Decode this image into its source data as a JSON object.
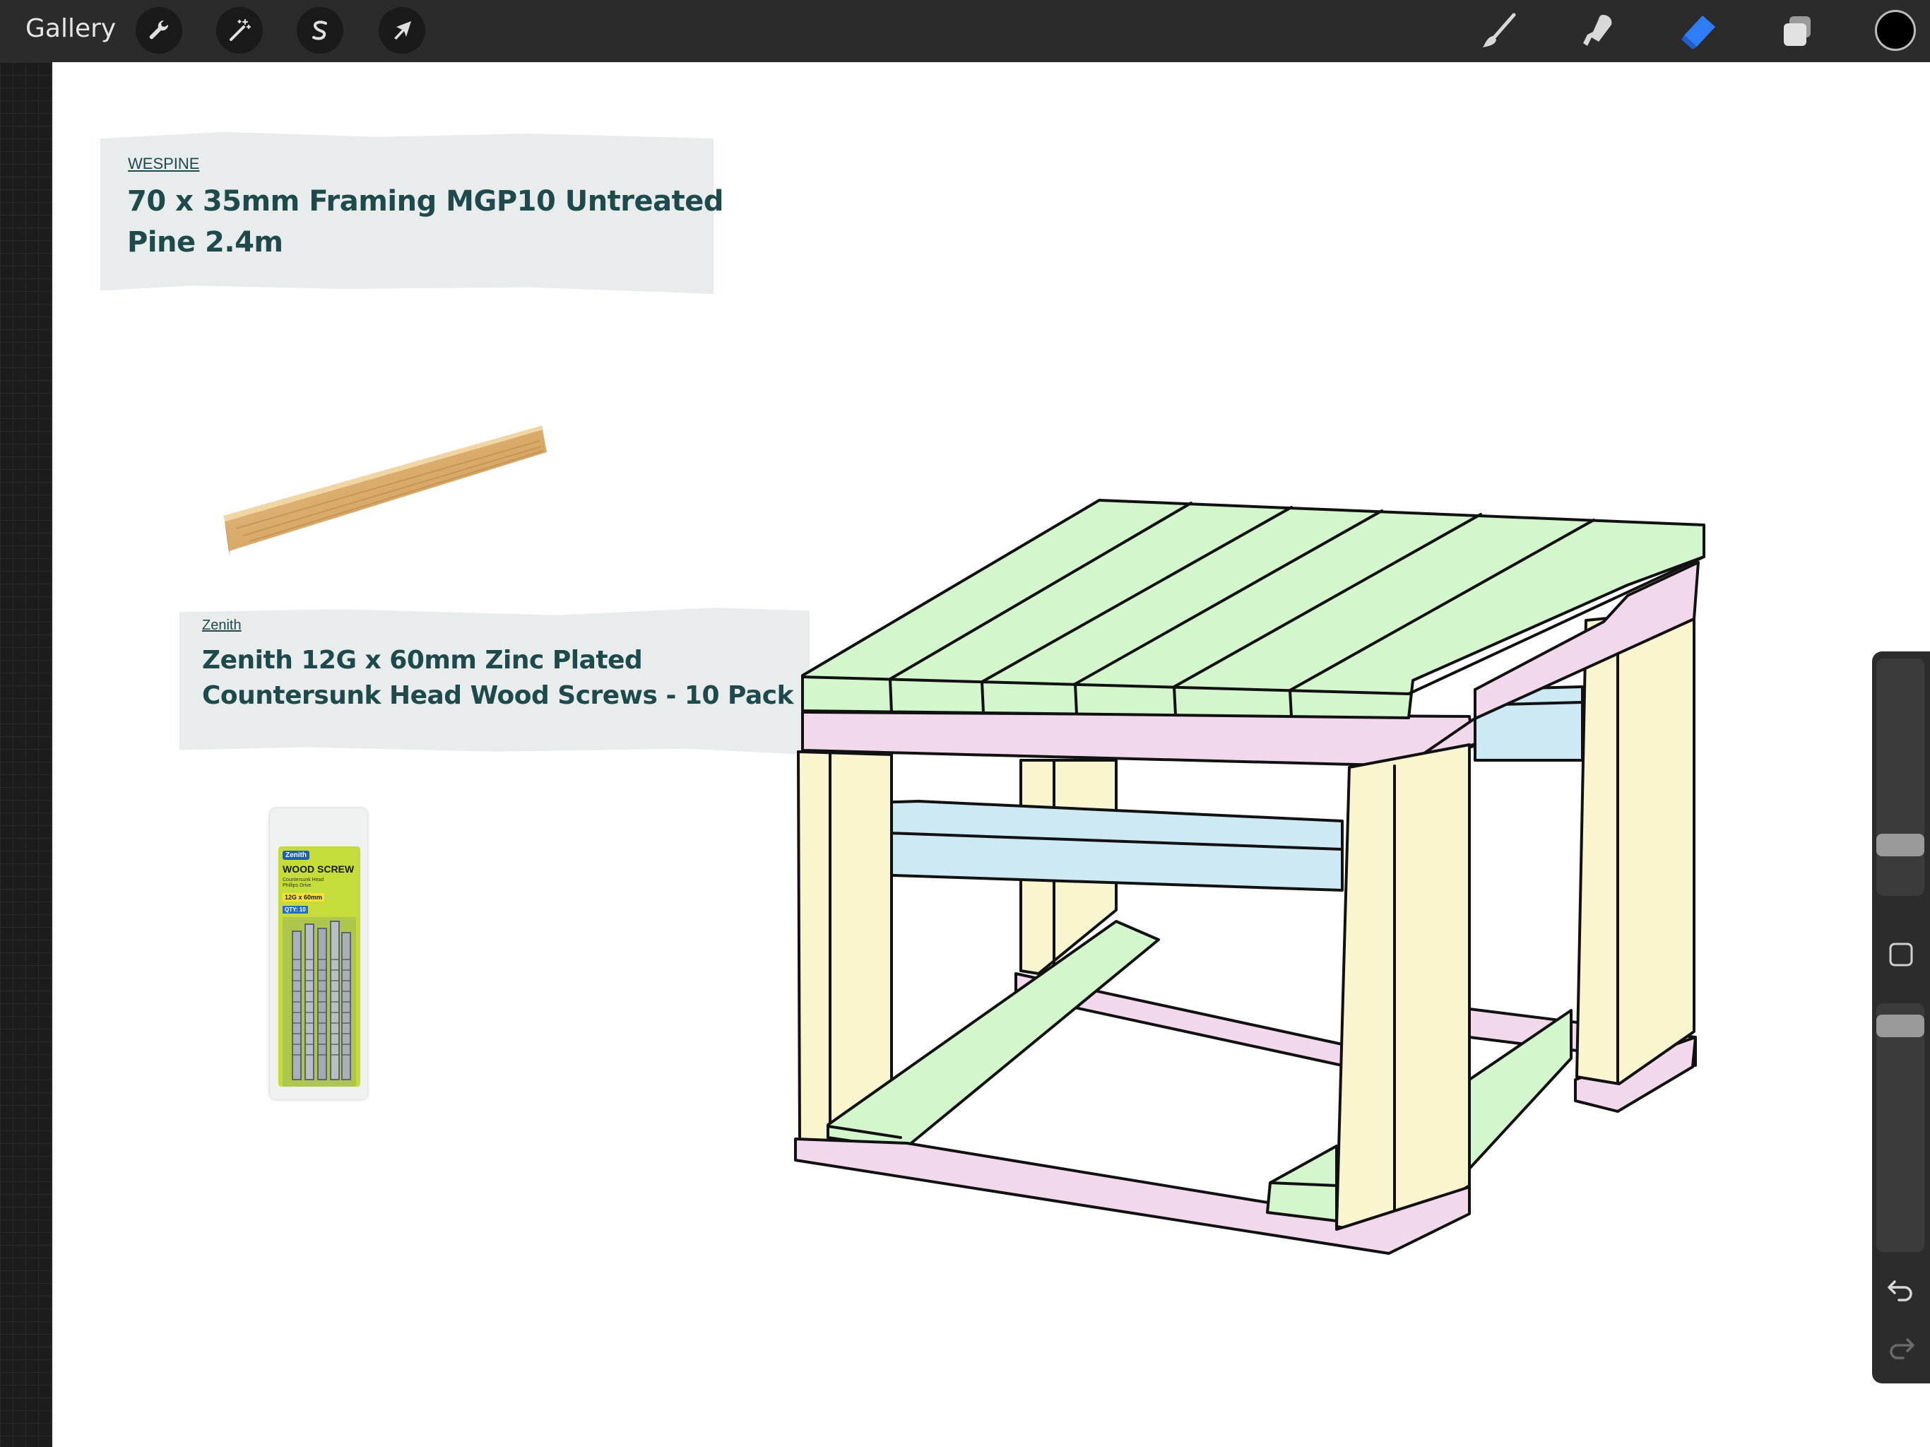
{
  "topbar": {
    "gallery_label": "Gallery",
    "left_tools": [
      {
        "name": "actions",
        "icon": "wrench-icon"
      },
      {
        "name": "adjustments",
        "icon": "magic-wand-icon"
      },
      {
        "name": "selection",
        "icon": "selection-s-icon"
      },
      {
        "name": "transform",
        "icon": "cursor-arrow-icon"
      }
    ],
    "right_tools": [
      {
        "name": "brush",
        "icon": "brush-icon"
      },
      {
        "name": "smudge",
        "icon": "smudge-icon"
      },
      {
        "name": "eraser",
        "icon": "eraser-icon",
        "active_color": "#2f7df6"
      },
      {
        "name": "layers",
        "icon": "layers-icon"
      }
    ],
    "current_color": "#000000"
  },
  "canvas": {
    "product1": {
      "brand": "WESPINE",
      "title_line1": "70 x 35mm Framing MGP10 Untreated",
      "title_line2": "Pine 2.4m"
    },
    "product2": {
      "brand": "Zenith",
      "title_line1": "Zenith 12G x 60mm Zinc Plated",
      "title_line2": "Countersunk Head Wood Screws - 10 Pack",
      "package_brand": "Zenith",
      "package_title": "WOOD SCREW",
      "package_sub1": "Countersunk Head",
      "package_sub2": "Phillips Drive",
      "package_size": "12G x 60mm",
      "package_qty": "QTY: 10"
    },
    "sketch_colors": {
      "top": "#d3f6cc",
      "rail": "#f2d8eb",
      "leg": "#f8f5cf",
      "shelf": "#cde9f4",
      "outline": "#111111"
    }
  },
  "sidebar": {
    "undo_icon": "undo-icon",
    "redo_icon": "redo-icon",
    "modify_icon": "square-icon"
  }
}
